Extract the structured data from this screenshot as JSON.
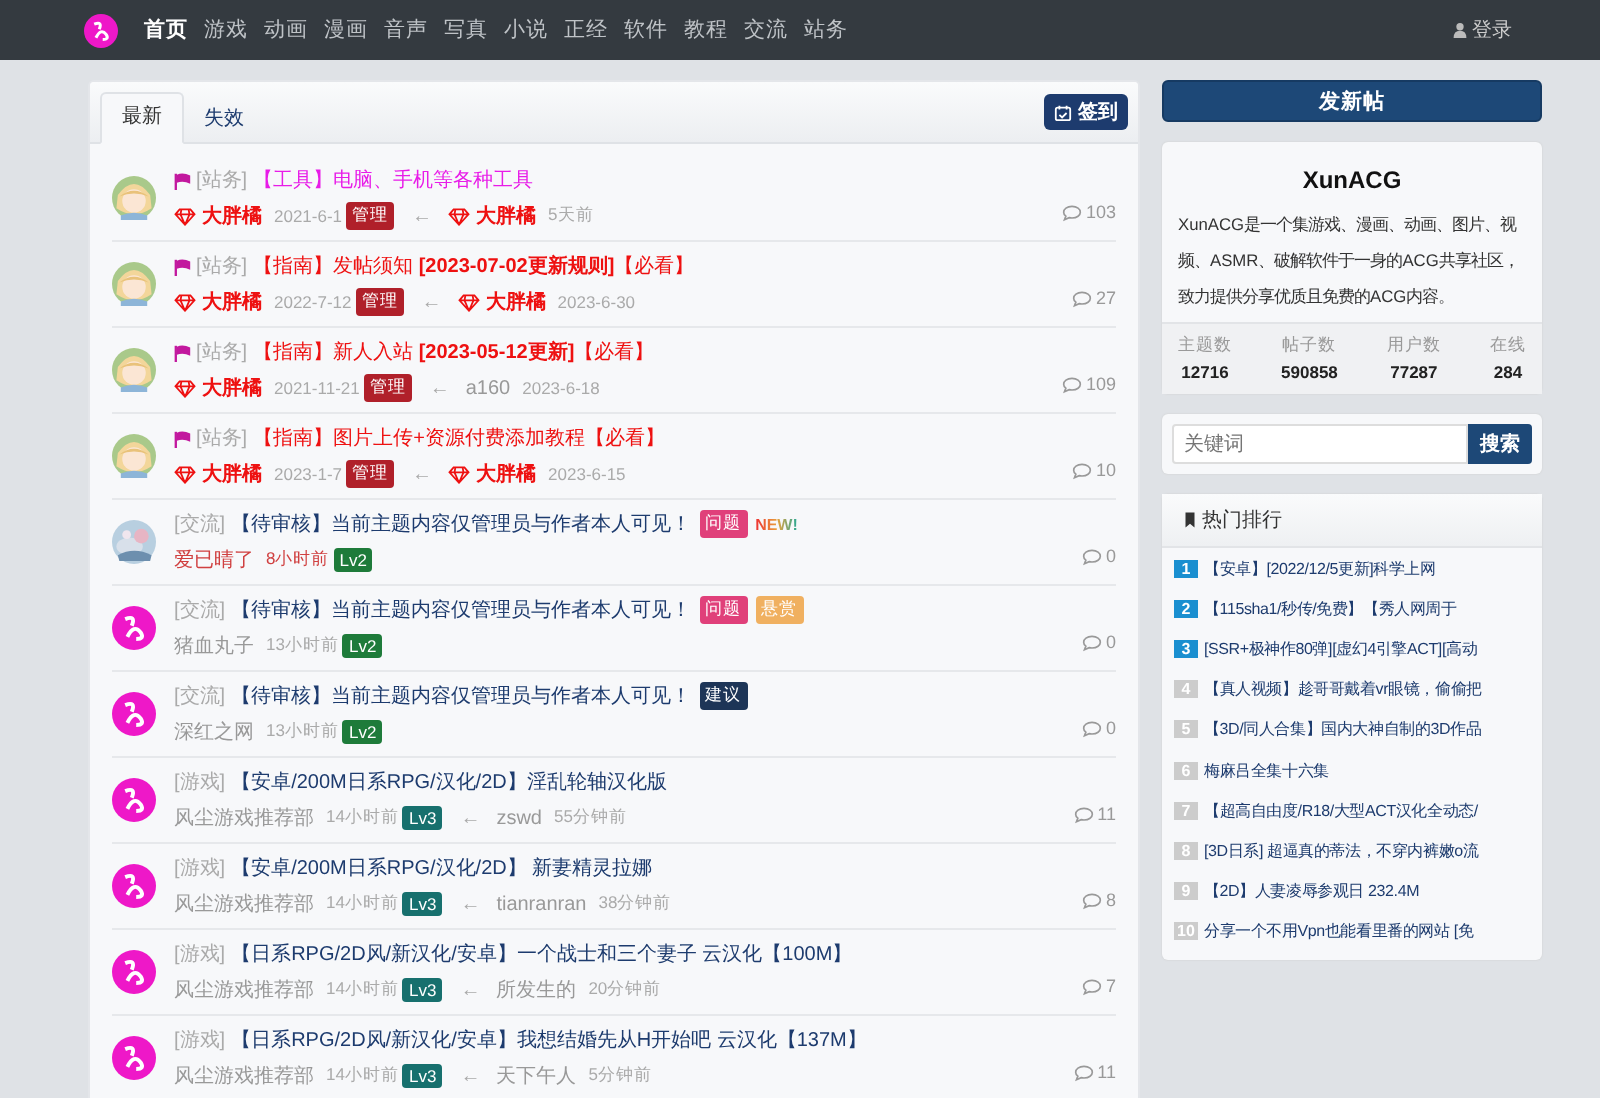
{
  "nav": {
    "items": [
      {
        "label": "首页",
        "selected": true
      },
      {
        "label": "游戏",
        "selected": false
      },
      {
        "label": "动画",
        "selected": false
      },
      {
        "label": "漫画",
        "selected": false
      },
      {
        "label": "音声",
        "selected": false
      },
      {
        "label": "写真",
        "selected": false
      },
      {
        "label": "小说",
        "selected": false
      },
      {
        "label": "正经",
        "selected": false
      },
      {
        "label": "软件",
        "selected": false
      },
      {
        "label": "教程",
        "selected": false
      },
      {
        "label": "交流",
        "selected": false
      },
      {
        "label": "站务",
        "selected": false
      }
    ],
    "login": "登录"
  },
  "tabs": [
    {
      "label": "最新",
      "selected": true
    },
    {
      "label": "失效",
      "selected": false
    }
  ],
  "checkin": "签到",
  "posts": [
    {
      "avatar": {
        "kind": "picture"
      },
      "pinned": true,
      "category": "[站务]",
      "title": {
        "text": "【工具】电脑、手机等各种工具",
        "color": "#e81ce8"
      },
      "author": {
        "name": "大胖橘",
        "vip": true,
        "highlight": false
      },
      "time": "2021-6-1",
      "badge": {
        "label": "管理",
        "color": "#b0202a"
      },
      "reply": {
        "arrow": "←",
        "name": "大胖橘",
        "vip": true,
        "time": "5天前"
      },
      "comments": "103"
    },
    {
      "avatar": {
        "kind": "picture"
      },
      "pinned": true,
      "category": "[站务]",
      "title": {
        "text": "【指南】发帖须知 **[2023-07-02更新规则]**【必看】",
        "color": "#ee1111"
      },
      "author": {
        "name": "大胖橘",
        "vip": true,
        "highlight": false
      },
      "time": "2022-7-12",
      "badge": {
        "label": "管理",
        "color": "#b0202a"
      },
      "reply": {
        "arrow": "←",
        "name": "大胖橘",
        "vip": true,
        "time": "2023-6-30"
      },
      "comments": "27"
    },
    {
      "avatar": {
        "kind": "picture"
      },
      "pinned": true,
      "category": "[站务]",
      "title": {
        "text": "【指南】新人入站 **[2023-05-12更新]**【必看】",
        "color": "#ee1111"
      },
      "author": {
        "name": "大胖橘",
        "vip": true,
        "highlight": false
      },
      "time": "2021-11-21",
      "badge": {
        "label": "管理",
        "color": "#b0202a"
      },
      "reply": {
        "arrow": "←",
        "name": "a160",
        "vip": false,
        "time": "2023-6-18"
      },
      "comments": "109"
    },
    {
      "avatar": {
        "kind": "picture"
      },
      "pinned": true,
      "category": "[站务]",
      "title": {
        "text": "【指南】图片上传+资源付费添加教程【必看】",
        "color": "#ee1111"
      },
      "author": {
        "name": "大胖橘",
        "vip": true,
        "highlight": false
      },
      "time": "2023-1-7",
      "badge": {
        "label": "管理",
        "color": "#b0202a"
      },
      "reply": {
        "arrow": "←",
        "name": "大胖橘",
        "vip": true,
        "time": "2023-6-15"
      },
      "comments": "10"
    },
    {
      "avatar": {
        "kind": "picture"
      },
      "pinned": false,
      "category": "[交流]",
      "title": {
        "text": "【待审核】当前主题内容仅管理员与作者本人可见！",
        "color": "#1d3b6e"
      },
      "tags": [
        {
          "label": "问题",
          "color": "#e0407a"
        }
      ],
      "new": "NEW!",
      "author": {
        "name": "爱已晴了",
        "vip": false,
        "highlight": true
      },
      "time": "8小时前",
      "badge": {
        "label": "Lv2",
        "color": "#1e7b3a"
      },
      "comments": "0"
    },
    {
      "avatar": {
        "kind": "logo"
      },
      "pinned": false,
      "category": "[交流]",
      "title": {
        "text": "【待审核】当前主题内容仅管理员与作者本人可见！",
        "color": "#1d3b6e"
      },
      "tags": [
        {
          "label": "问题",
          "color": "#e0407a"
        },
        {
          "label": "悬赏",
          "color": "#f0b060"
        }
      ],
      "author": {
        "name": "猪血丸子",
        "vip": false,
        "highlight": false
      },
      "time": "13小时前",
      "badge": {
        "label": "Lv2",
        "color": "#1e7b3a"
      },
      "comments": "0"
    },
    {
      "avatar": {
        "kind": "logo"
      },
      "pinned": false,
      "category": "[交流]",
      "title": {
        "text": "【待审核】当前主题内容仅管理员与作者本人可见！",
        "color": "#1d3b6e"
      },
      "tags": [
        {
          "label": "建议",
          "color": "#1d3557"
        }
      ],
      "author": {
        "name": "深红之网",
        "vip": false,
        "highlight": false
      },
      "time": "13小时前",
      "badge": {
        "label": "Lv2",
        "color": "#1e7b3a"
      },
      "comments": "0"
    },
    {
      "avatar": {
        "kind": "logo"
      },
      "pinned": false,
      "category": "[游戏]",
      "title": {
        "text": "【安卓/200M日系RPG/汉化/2D】淫乱轮轴汉化版",
        "color": "#1d3b6e"
      },
      "author": {
        "name": "风尘游戏推荐部",
        "vip": false,
        "highlight": false
      },
      "time": "14小时前",
      "badge": {
        "label": "Lv3",
        "color": "#17706e"
      },
      "reply": {
        "arrow": "←",
        "name": "zswd",
        "vip": false,
        "time": "55分钟前"
      },
      "comments": "11"
    },
    {
      "avatar": {
        "kind": "logo"
      },
      "pinned": false,
      "category": "[游戏]",
      "title": {
        "text": "【安卓/200M日系RPG/汉化/2D】 新妻精灵拉娜",
        "color": "#1d3b6e"
      },
      "author": {
        "name": "风尘游戏推荐部",
        "vip": false,
        "highlight": false
      },
      "time": "14小时前",
      "badge": {
        "label": "Lv3",
        "color": "#17706e"
      },
      "reply": {
        "arrow": "←",
        "name": "tianranran",
        "vip": false,
        "time": "38分钟前"
      },
      "comments": "8"
    },
    {
      "avatar": {
        "kind": "logo"
      },
      "pinned": false,
      "category": "[游戏]",
      "title": {
        "text": "【日系RPG/2D风/新汉化/安卓】一个战士和三个妻子 云汉化【100M】",
        "color": "#1d3b6e"
      },
      "author": {
        "name": "风尘游戏推荐部",
        "vip": false,
        "highlight": false
      },
      "time": "14小时前",
      "badge": {
        "label": "Lv3",
        "color": "#17706e"
      },
      "reply": {
        "arrow": "←",
        "name": "所发生的",
        "vip": false,
        "time": "20分钟前"
      },
      "comments": "7"
    },
    {
      "avatar": {
        "kind": "logo"
      },
      "pinned": false,
      "category": "[游戏]",
      "title": {
        "text": "【日系RPG/2D风/新汉化/安卓】我想结婚先从H开始吧 云汉化【137M】",
        "color": "#1d3b6e"
      },
      "author": {
        "name": "风尘游戏推荐部",
        "vip": false,
        "highlight": false
      },
      "time": "14小时前",
      "badge": {
        "label": "Lv3",
        "color": "#17706e"
      },
      "reply": {
        "arrow": "←",
        "name": "天下午人",
        "vip": false,
        "time": "5分钟前"
      },
      "comments": "11"
    }
  ],
  "sidebar": {
    "new_post": "发新帖",
    "site": {
      "name": "XunACG",
      "description": "XunACG是一个集游戏、漫画、动画、图片、视频、ASMR、破解软件于一身的ACG共享社区，致力提供分享优质且免费的ACG内容。",
      "stats": [
        {
          "label": "主题数",
          "value": "12716"
        },
        {
          "label": "帖子数",
          "value": "590858"
        },
        {
          "label": "用户数",
          "value": "77287"
        },
        {
          "label": "在线",
          "value": "284"
        }
      ]
    },
    "search": {
      "placeholder": "关键词",
      "button": "搜索"
    },
    "hot": {
      "title": "热门排行",
      "items": [
        {
          "rank": "1",
          "color": "#1a8fd0",
          "title": "【安卓】[2022/12/5更新]科学上网"
        },
        {
          "rank": "2",
          "color": "#1a8fd0",
          "title": "【115sha1/秒传/免费】【秀人网周于"
        },
        {
          "rank": "3",
          "color": "#1a8fd0",
          "title": "[SSR+极神作80弹][虚幻4引擎ACT][高动"
        },
        {
          "rank": "4",
          "color": "#cccccc",
          "title": "【真人视频】趁哥哥戴着vr眼镜，偷偷把"
        },
        {
          "rank": "5",
          "color": "#cccccc",
          "title": "【3D/同人合集】国内大神自制的3D作品"
        },
        {
          "rank": "6",
          "color": "#cccccc",
          "title": "梅麻吕全集十六集"
        },
        {
          "rank": "7",
          "color": "#cccccc",
          "title": "【超高自由度/R18/大型ACT汉化全动态/"
        },
        {
          "rank": "8",
          "color": "#cccccc",
          "title": "[3D日系] 超逼真的蒂法，不穿内裤嫩o流"
        },
        {
          "rank": "9",
          "color": "#cccccc",
          "title": "【2D】人妻凌辱参观日 232.4M"
        },
        {
          "rank": "10",
          "color": "#cccccc",
          "title": "分享一个不用Vpn也能看里番的网站 [免"
        }
      ]
    }
  }
}
